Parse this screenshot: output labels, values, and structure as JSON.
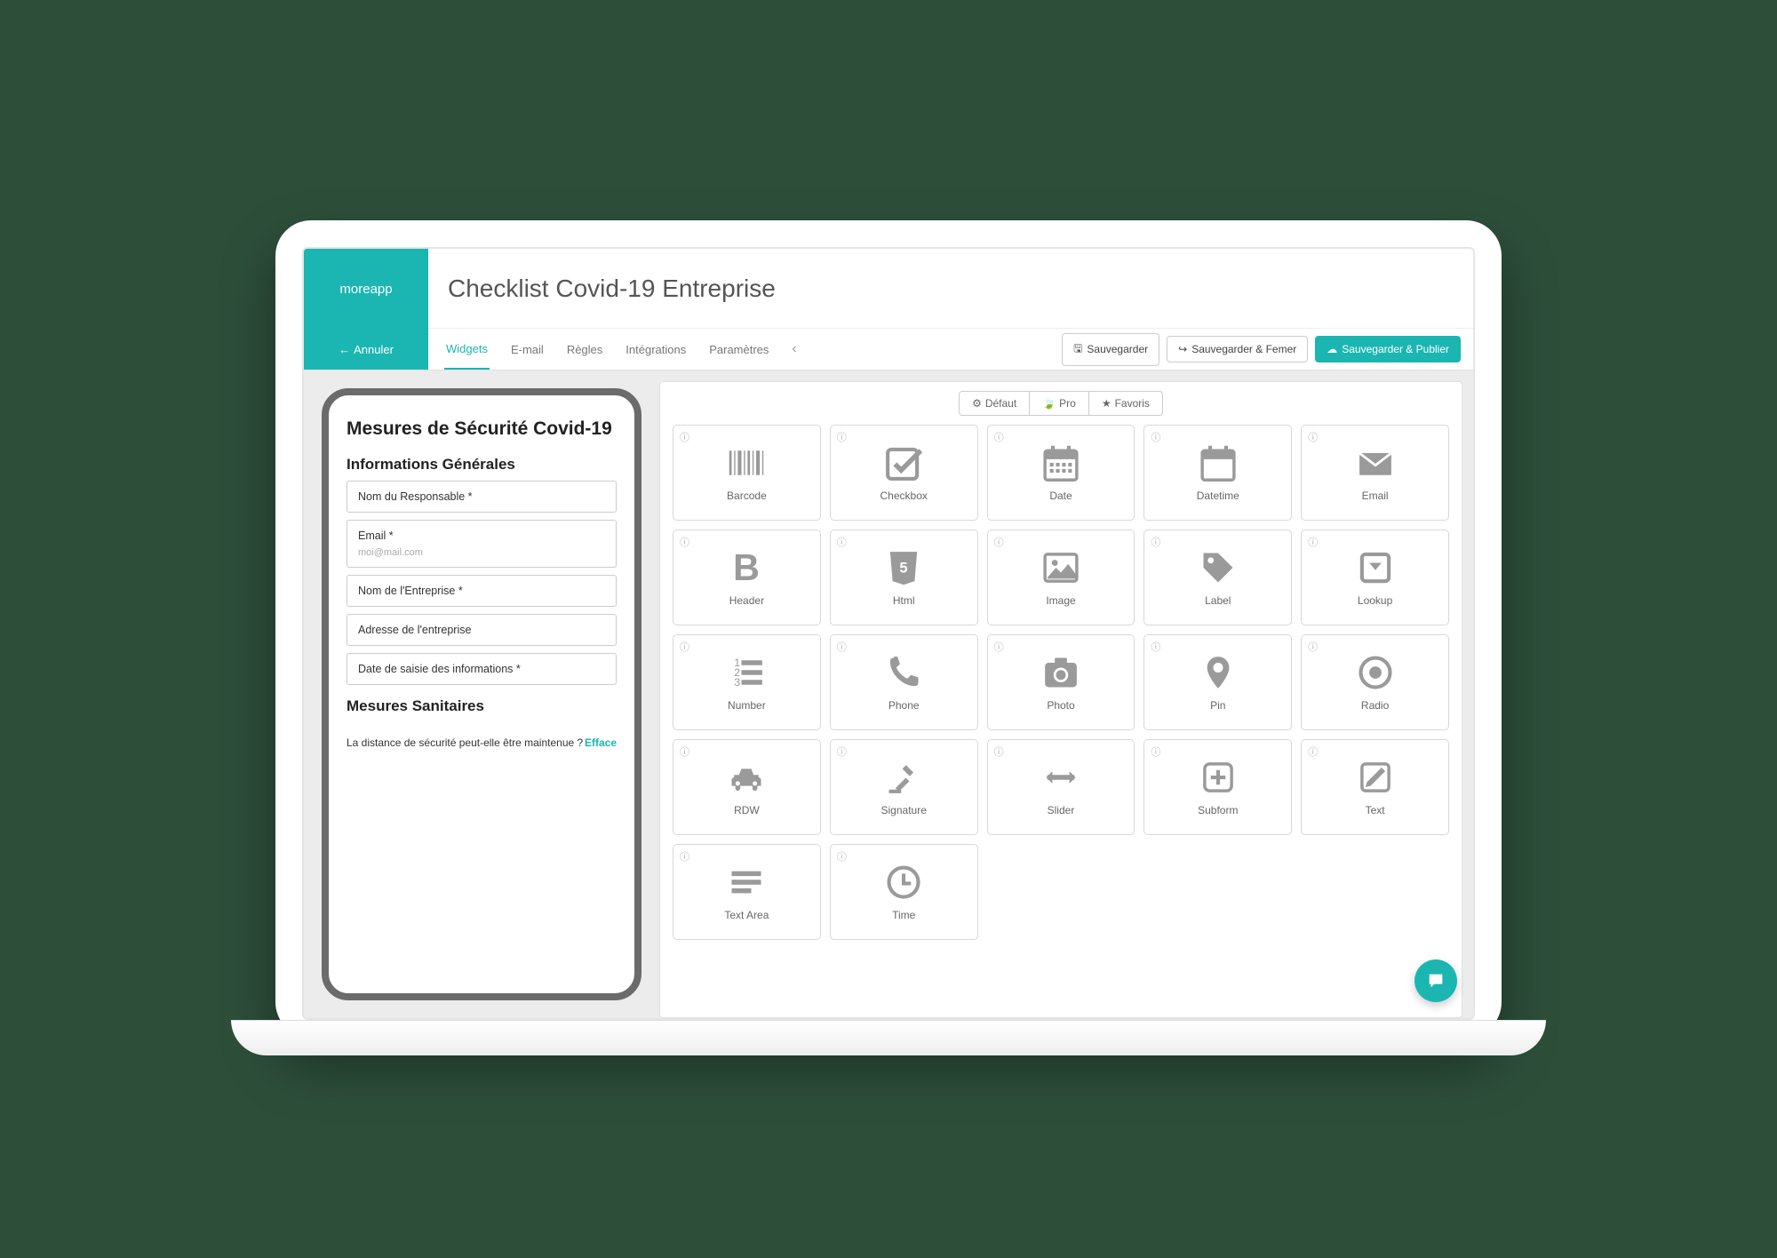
{
  "logo": "moreapp",
  "page_title": "Checklist Covid-19 Entreprise",
  "back_label": "Annuler",
  "tabs": [
    "Widgets",
    "E-mail",
    "Règles",
    "Intégrations",
    "Paramètres"
  ],
  "active_tab": 0,
  "buttons": {
    "save": "Sauvegarder",
    "save_close": "Sauvegarder & Femer",
    "save_publish": "Sauvegarder & Publier"
  },
  "filters": [
    "Défaut",
    "Pro",
    "Favoris"
  ],
  "preview": {
    "title": "Mesures de Sécurité Covid-19",
    "section1": "Informations Générales",
    "fields": [
      {
        "label": "Nom du Responsable *",
        "placeholder": ""
      },
      {
        "label": "Email *",
        "placeholder": "moi@mail.com"
      },
      {
        "label": "Nom de l'Entreprise *",
        "placeholder": ""
      },
      {
        "label": "Adresse de l'entreprise",
        "placeholder": ""
      },
      {
        "label": "Date de saisie des informations *",
        "placeholder": ""
      }
    ],
    "section2": "Mesures Sanitaires",
    "question": "La distance de sécurité peut-elle être maintenue ?",
    "clear": "Efface"
  },
  "widgets": [
    {
      "name": "Barcode",
      "icon": "barcode"
    },
    {
      "name": "Checkbox",
      "icon": "checkbox"
    },
    {
      "name": "Date",
      "icon": "date"
    },
    {
      "name": "Datetime",
      "icon": "datetime"
    },
    {
      "name": "Email",
      "icon": "email"
    },
    {
      "name": "Header",
      "icon": "header"
    },
    {
      "name": "Html",
      "icon": "html"
    },
    {
      "name": "Image",
      "icon": "image"
    },
    {
      "name": "Label",
      "icon": "label"
    },
    {
      "name": "Lookup",
      "icon": "lookup"
    },
    {
      "name": "Number",
      "icon": "number"
    },
    {
      "name": "Phone",
      "icon": "phone"
    },
    {
      "name": "Photo",
      "icon": "photo"
    },
    {
      "name": "Pin",
      "icon": "pin"
    },
    {
      "name": "Radio",
      "icon": "radio"
    },
    {
      "name": "RDW",
      "icon": "rdw"
    },
    {
      "name": "Signature",
      "icon": "signature"
    },
    {
      "name": "Slider",
      "icon": "slider"
    },
    {
      "name": "Subform",
      "icon": "subform"
    },
    {
      "name": "Text",
      "icon": "text"
    },
    {
      "name": "Text Area",
      "icon": "textarea"
    },
    {
      "name": "Time",
      "icon": "time"
    }
  ]
}
